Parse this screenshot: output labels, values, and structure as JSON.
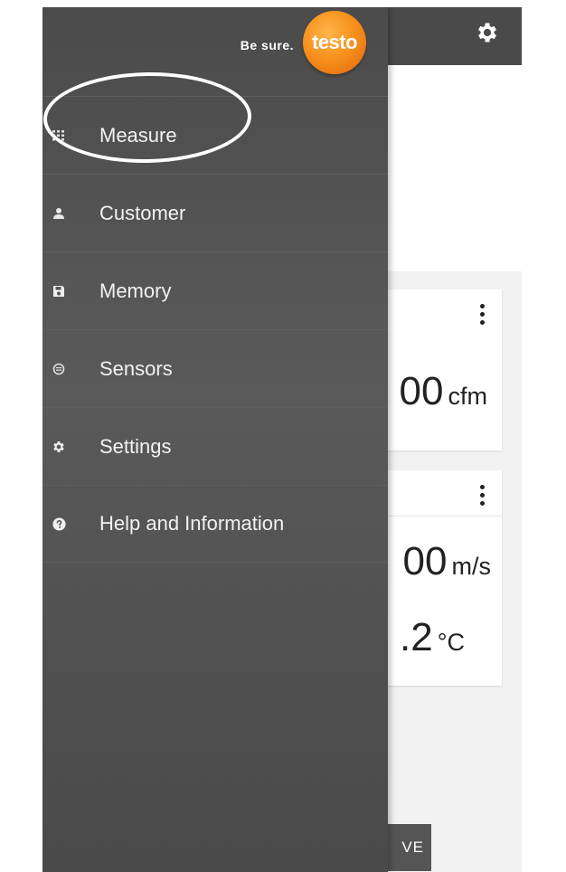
{
  "header": {
    "settings_icon": "gear-icon"
  },
  "cards": [
    {
      "readings": [
        {
          "value": "00",
          "unit": "cfm"
        }
      ]
    },
    {
      "readings": [
        {
          "value": "00",
          "unit": "m/s"
        },
        {
          "value": ".2",
          "unit": "°C"
        }
      ]
    }
  ],
  "save_button": {
    "label": "VE"
  },
  "drawer": {
    "tagline": "Be sure.",
    "logo_text": "testo",
    "logo_color": "#f7921e",
    "items": [
      {
        "label": "Measure",
        "icon": "grid-icon"
      },
      {
        "label": "Customer",
        "icon": "person-icon"
      },
      {
        "label": "Memory",
        "icon": "save-icon"
      },
      {
        "label": "Sensors",
        "icon": "sensor-icon"
      },
      {
        "label": "Settings",
        "icon": "gear-icon"
      },
      {
        "label": "Help and Information",
        "icon": "help-icon"
      }
    ]
  },
  "colors": {
    "drawer_bg": "#4f4f4f",
    "header_bg": "#4a4a4a",
    "highlight_ring": "#ffffff"
  }
}
